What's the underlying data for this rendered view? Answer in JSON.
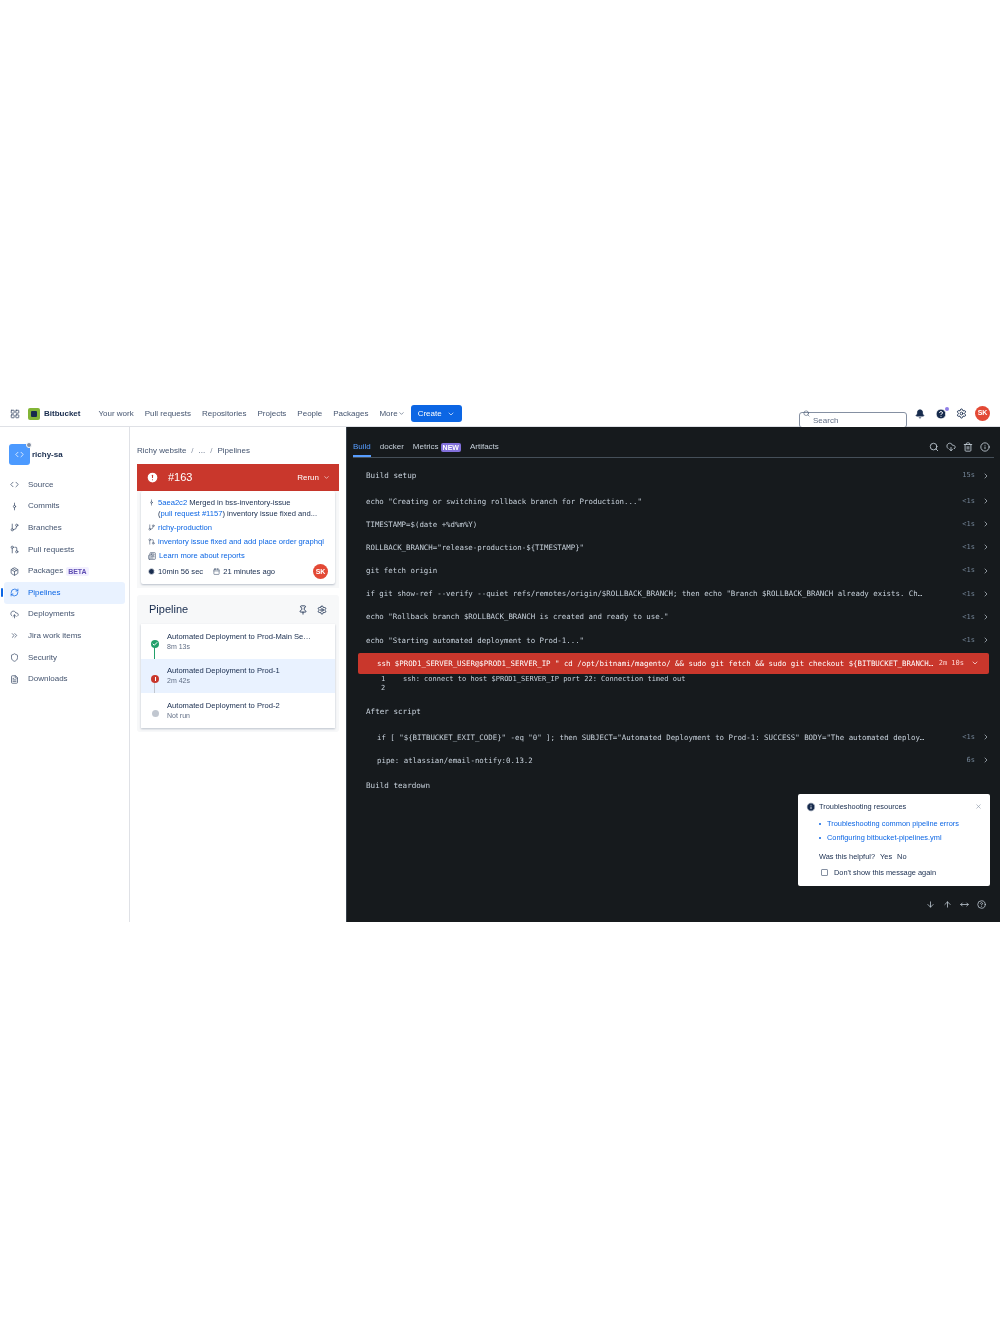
{
  "topbar": {
    "app_name": "Bitbucket",
    "nav": [
      "Your work",
      "Pull requests",
      "Repositories",
      "Projects",
      "People",
      "Packages"
    ],
    "more": "More",
    "create": "Create",
    "search": {
      "placeholder": "Search"
    },
    "help_dot": true,
    "avatar": "SK"
  },
  "sidebar": {
    "workspace": "richy-sa",
    "items": [
      {
        "label": "Source",
        "selected": false
      },
      {
        "label": "Commits",
        "selected": false
      },
      {
        "label": "Branches",
        "selected": false
      },
      {
        "label": "Pull requests",
        "selected": false
      },
      {
        "label": "Packages",
        "badge": "BETA",
        "selected": false
      },
      {
        "label": "Pipelines",
        "selected": true
      },
      {
        "label": "Deployments",
        "selected": false
      },
      {
        "label": "Jira work items",
        "selected": false
      },
      {
        "label": "Security",
        "selected": false
      },
      {
        "label": "Downloads",
        "selected": false
      }
    ]
  },
  "breadcrumbs": [
    {
      "kind": "link",
      "text": "Richy website"
    },
    {
      "kind": "separator",
      "text": "/"
    },
    {
      "kind": "link",
      "text": "..."
    },
    {
      "kind": "separator",
      "text": "/"
    },
    {
      "kind": "link",
      "text": "Pipelines"
    }
  ],
  "build": {
    "number": "#163",
    "failed": true,
    "rerun": "Rerun",
    "commit": {
      "hash": "5aea2c2",
      "text_before": "Merged in bss-inventory-issue (",
      "pr": "pull request #1157",
      "text_after": ") inventory issue fixed and..."
    },
    "branch": "richy-production",
    "pr_title": "inventory issue fixed and add place order graphql",
    "reports_link": "Learn more about reports",
    "duration": "10min 56 sec",
    "started": "21 minutes ago",
    "avatar": "SK"
  },
  "pipeline": {
    "title": "Pipeline",
    "steps": [
      {
        "name": "Automated Deployment to Prod-Main Se…",
        "duration": "8m 13s",
        "kind": "success",
        "selected": false
      },
      {
        "name": "Automated Deployment to Prod-1",
        "duration": "2m 42s",
        "kind": "failed",
        "selected": true
      },
      {
        "name": "Automated Deployment to Prod-2",
        "duration": "Not run",
        "kind": "not_run",
        "selected": false
      }
    ]
  },
  "log": {
    "tabs": [
      {
        "label": "Build",
        "selected": true
      },
      {
        "label": "docker",
        "selected": false
      },
      {
        "label": "Metrics",
        "badge": "NEW",
        "selected": false
      },
      {
        "label": "Artifacts",
        "selected": false
      }
    ],
    "lines": [
      {
        "kind": "section",
        "text": "Build setup",
        "duration": "15s"
      },
      {
        "kind": "command",
        "text": "echo \"Creating or switching rollback branch for Production...\"",
        "duration": "<1s",
        "failed": false
      },
      {
        "kind": "command",
        "text": "TIMESTAMP=$(date +%d%m%Y)",
        "duration": "<1s",
        "failed": false
      },
      {
        "kind": "command",
        "text": "ROLLBACK_BRANCH=\"release-production-${TIMESTAMP}\"",
        "duration": "<1s",
        "failed": false
      },
      {
        "kind": "command",
        "text": "git fetch origin",
        "duration": "<1s",
        "failed": false
      },
      {
        "kind": "command",
        "text": "if git show-ref --verify --quiet refs/remotes/origin/$ROLLBACK_BRANCH; then echo \"Branch $ROLLBACK_BRANCH already exists. Ch…",
        "duration": "<1s",
        "failed": false
      },
      {
        "kind": "command",
        "text": "echo \"Rollback branch $ROLLBACK_BRANCH is created and ready to use.\"",
        "duration": "<1s",
        "failed": false
      },
      {
        "kind": "command",
        "text": "echo \"Starting automated deployment to Prod-1...\"",
        "duration": "<1s",
        "failed": false
      },
      {
        "kind": "command",
        "text": "ssh $PROD1_SERVER_USER@$PROD1_SERVER_IP \" cd /opt/bitnami/magento/ && sudo git fetch && sudo git checkout ${BITBUCKET_BRANCH…",
        "duration": "2m 10s",
        "failed": true,
        "output": [
          {
            "number": "1",
            "text": "ssh: connect to host $PROD1_SERVER_IP port 22: Connection timed out"
          },
          {
            "number": "2"
          }
        ]
      },
      {
        "kind": "section",
        "text": "After script"
      },
      {
        "kind": "sub_command",
        "text": "if [ \"${BITBUCKET_EXIT_CODE}\" -eq \"0\" ]; then SUBJECT=\"Automated Deployment to Prod-1: SUCCESS\" BODY=\"The automated deploy…",
        "duration": "<1s",
        "failed": false
      },
      {
        "kind": "sub_command",
        "text": "pipe: atlassian/email-notify:0.13.2",
        "duration": "6s",
        "failed": false
      },
      {
        "kind": "section",
        "text": "Build teardown"
      }
    ]
  },
  "popup": {
    "title": "Troubleshooting resources",
    "links": [
      "Troubleshooting common pipeline errors",
      "Configuring bitbucket-pipelines.yml"
    ],
    "question": "Was this helpful?",
    "answers": [
      "Yes",
      "No"
    ],
    "checkbox": {
      "label": "Don't show this message again",
      "checked": false
    }
  }
}
